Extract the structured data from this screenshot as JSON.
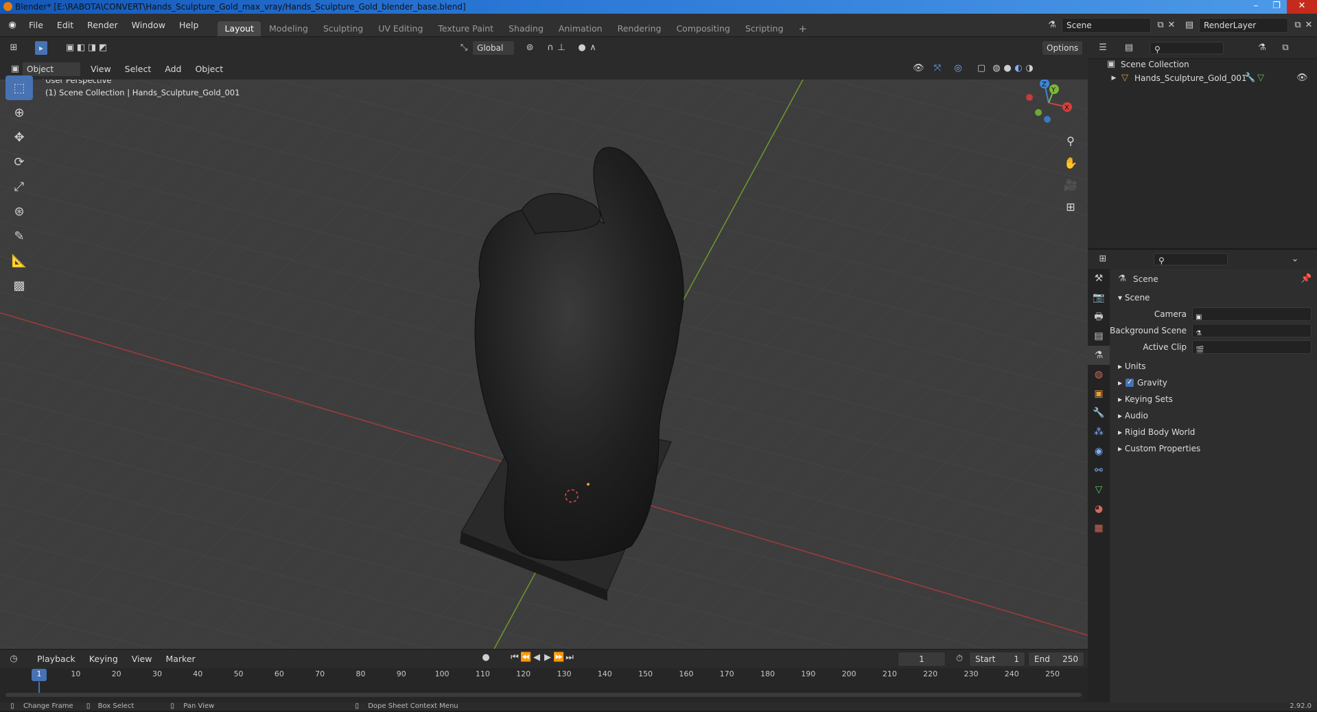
{
  "window": {
    "title": "Blender* [E:\\RABOTA\\CONVERT\\Hands_Sculpture_Gold_max_vray/Hands_Sculpture_Gold_blender_base.blend]"
  },
  "menubar": {
    "menus": [
      "File",
      "Edit",
      "Render",
      "Window",
      "Help"
    ],
    "workspaces": [
      "Layout",
      "Modeling",
      "Sculpting",
      "UV Editing",
      "Texture Paint",
      "Shading",
      "Animation",
      "Rendering",
      "Compositing",
      "Scripting"
    ],
    "active_workspace": "Layout",
    "scene": "Scene",
    "view_layer": "RenderLayer"
  },
  "viewport_header": {
    "mode": "Object Mode",
    "menus": [
      "View",
      "Select",
      "Add",
      "Object"
    ],
    "orientation": "Global",
    "options_label": "Options"
  },
  "viewport": {
    "perspective": "User Perspective",
    "context": "(1) Scene Collection | Hands_Sculpture_Gold_001",
    "gizmo_axes": [
      "Z",
      "Y",
      "X"
    ]
  },
  "outliner": {
    "root": "Scene Collection",
    "items": [
      "Hands_Sculpture_Gold_001"
    ]
  },
  "properties": {
    "breadcrumb": "Scene",
    "panel_title": "Scene",
    "fields": [
      {
        "label": "Camera",
        "value": ""
      },
      {
        "label": "Background Scene",
        "value": ""
      },
      {
        "label": "Active Clip",
        "value": ""
      }
    ],
    "subpanels": [
      "Units",
      "Gravity",
      "Keying Sets",
      "Audio",
      "Rigid Body World",
      "Custom Properties"
    ],
    "gravity_checked": true
  },
  "timeline": {
    "menus": [
      "Playback",
      "Keying",
      "View",
      "Marker"
    ],
    "current_frame": "1",
    "start_label": "Start",
    "start": "1",
    "end_label": "End",
    "end": "250",
    "ruler_ticks": [
      "1",
      "10",
      "20",
      "30",
      "40",
      "50",
      "60",
      "70",
      "80",
      "90",
      "100",
      "110",
      "120",
      "130",
      "140",
      "150",
      "160",
      "170",
      "180",
      "190",
      "200",
      "210",
      "220",
      "230",
      "240",
      "250"
    ]
  },
  "statusbar": {
    "hints": [
      "Change Frame",
      "Box Select",
      "Pan View",
      "Dope Sheet Context Menu"
    ],
    "version": "2.92.0"
  },
  "colors": {
    "accent": "#4772b3",
    "x_axis": "#d4403e",
    "y_axis": "#7ab83a",
    "z_axis": "#3d87d6"
  }
}
